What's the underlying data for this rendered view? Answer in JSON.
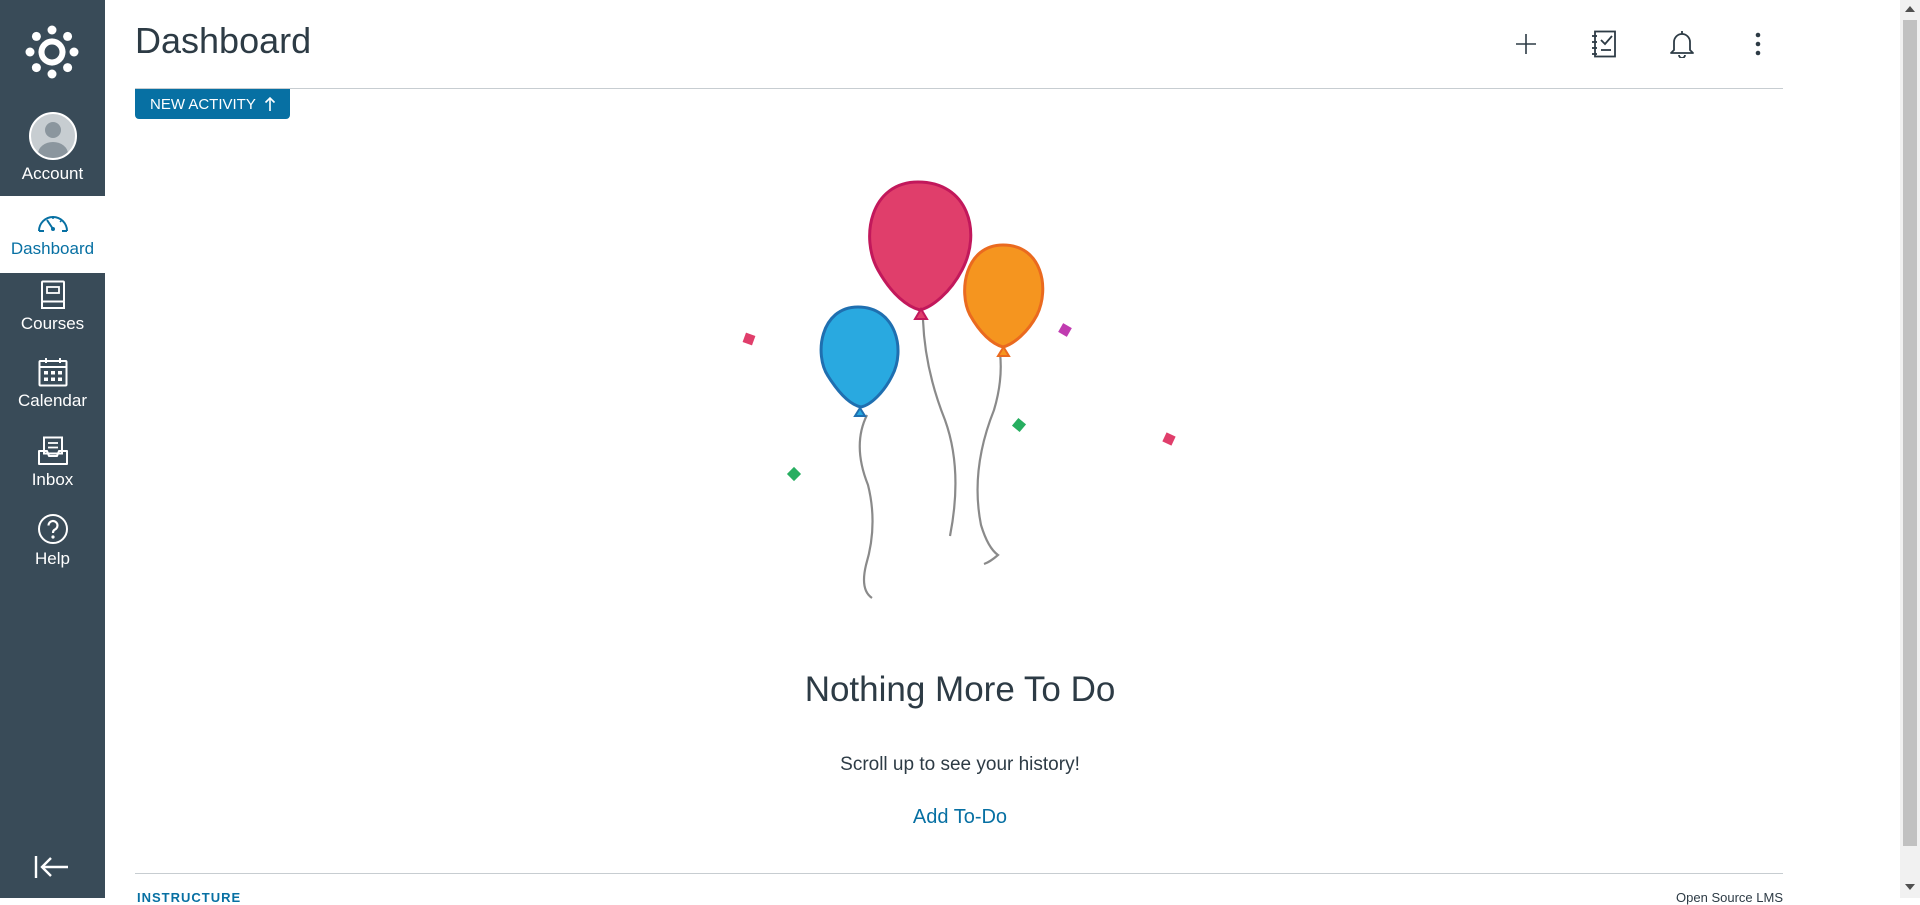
{
  "nav": {
    "account": "Account",
    "dashboard": "Dashboard",
    "courses": "Courses",
    "calendar": "Calendar",
    "inbox": "Inbox",
    "help": "Help"
  },
  "header": {
    "title": "Dashboard",
    "new_activity": "NEW ACTIVITY"
  },
  "empty_state": {
    "title": "Nothing More To Do",
    "subtitle": "Scroll up to see your history!",
    "add_todo": "Add To-Do"
  },
  "footer": {
    "logo": "INSTRUCTURE",
    "right": "Open Source LMS"
  },
  "colors": {
    "nav_bg": "#394b58",
    "accent": "#0770a3",
    "balloon_pink": "#e03e6b",
    "balloon_orange": "#f5951f",
    "balloon_blue": "#29a9e0"
  },
  "icons": [
    "canvas-logo-icon",
    "user-icon",
    "speedometer-icon",
    "book-icon",
    "calendar-icon",
    "inbox-icon",
    "help-icon",
    "collapse-nav-icon",
    "plus-icon",
    "todo-list-icon",
    "bell-icon",
    "more-vertical-icon",
    "arrow-up-icon"
  ]
}
